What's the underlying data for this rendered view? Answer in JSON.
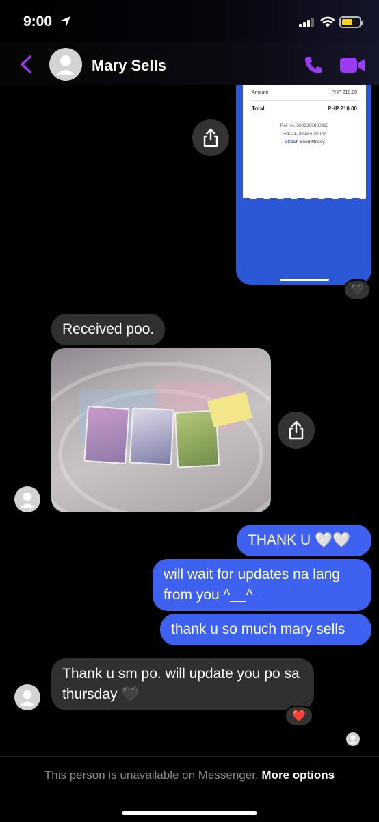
{
  "status_bar": {
    "time": "9:00",
    "icons": [
      "location-arrow-icon",
      "signal-icon",
      "wifi-icon",
      "battery-icon"
    ],
    "battery_color": "#f5d223"
  },
  "header": {
    "contact_name": "Mary Sells",
    "accent_color": "#9b3cf0",
    "icons": [
      "back-chevron-icon",
      "phone-icon",
      "video-camera-icon"
    ]
  },
  "receipt": {
    "amount_label": "Amount",
    "amount_value": "PHP 210.00",
    "total_label": "Total",
    "total_value": "PHP 210.00",
    "ref": "Ref No. 5008306830913",
    "date": "Feb 21, 2023 6:30 PM",
    "brand": "GCash",
    "brand_suffix": "Send Money",
    "reaction": "🖤"
  },
  "messages": [
    {
      "direction": "in",
      "text": "Received poo."
    },
    {
      "direction": "in",
      "type": "photo"
    },
    {
      "direction": "out",
      "text": "THANK U 🤍🤍"
    },
    {
      "direction": "out",
      "text": "will wait for updates na lang from you ^__^"
    },
    {
      "direction": "out",
      "text": "thank u so much mary sells"
    },
    {
      "direction": "in",
      "text": "Thank u sm po. will update you po sa thursday 🖤",
      "reaction": "❤️"
    }
  ],
  "footer": {
    "notice": "This person is unavailable on Messenger.",
    "more_options": "More options"
  },
  "colors": {
    "outgoing_bubble": "#3e61f0",
    "incoming_bubble": "#303030",
    "background": "#000000"
  }
}
